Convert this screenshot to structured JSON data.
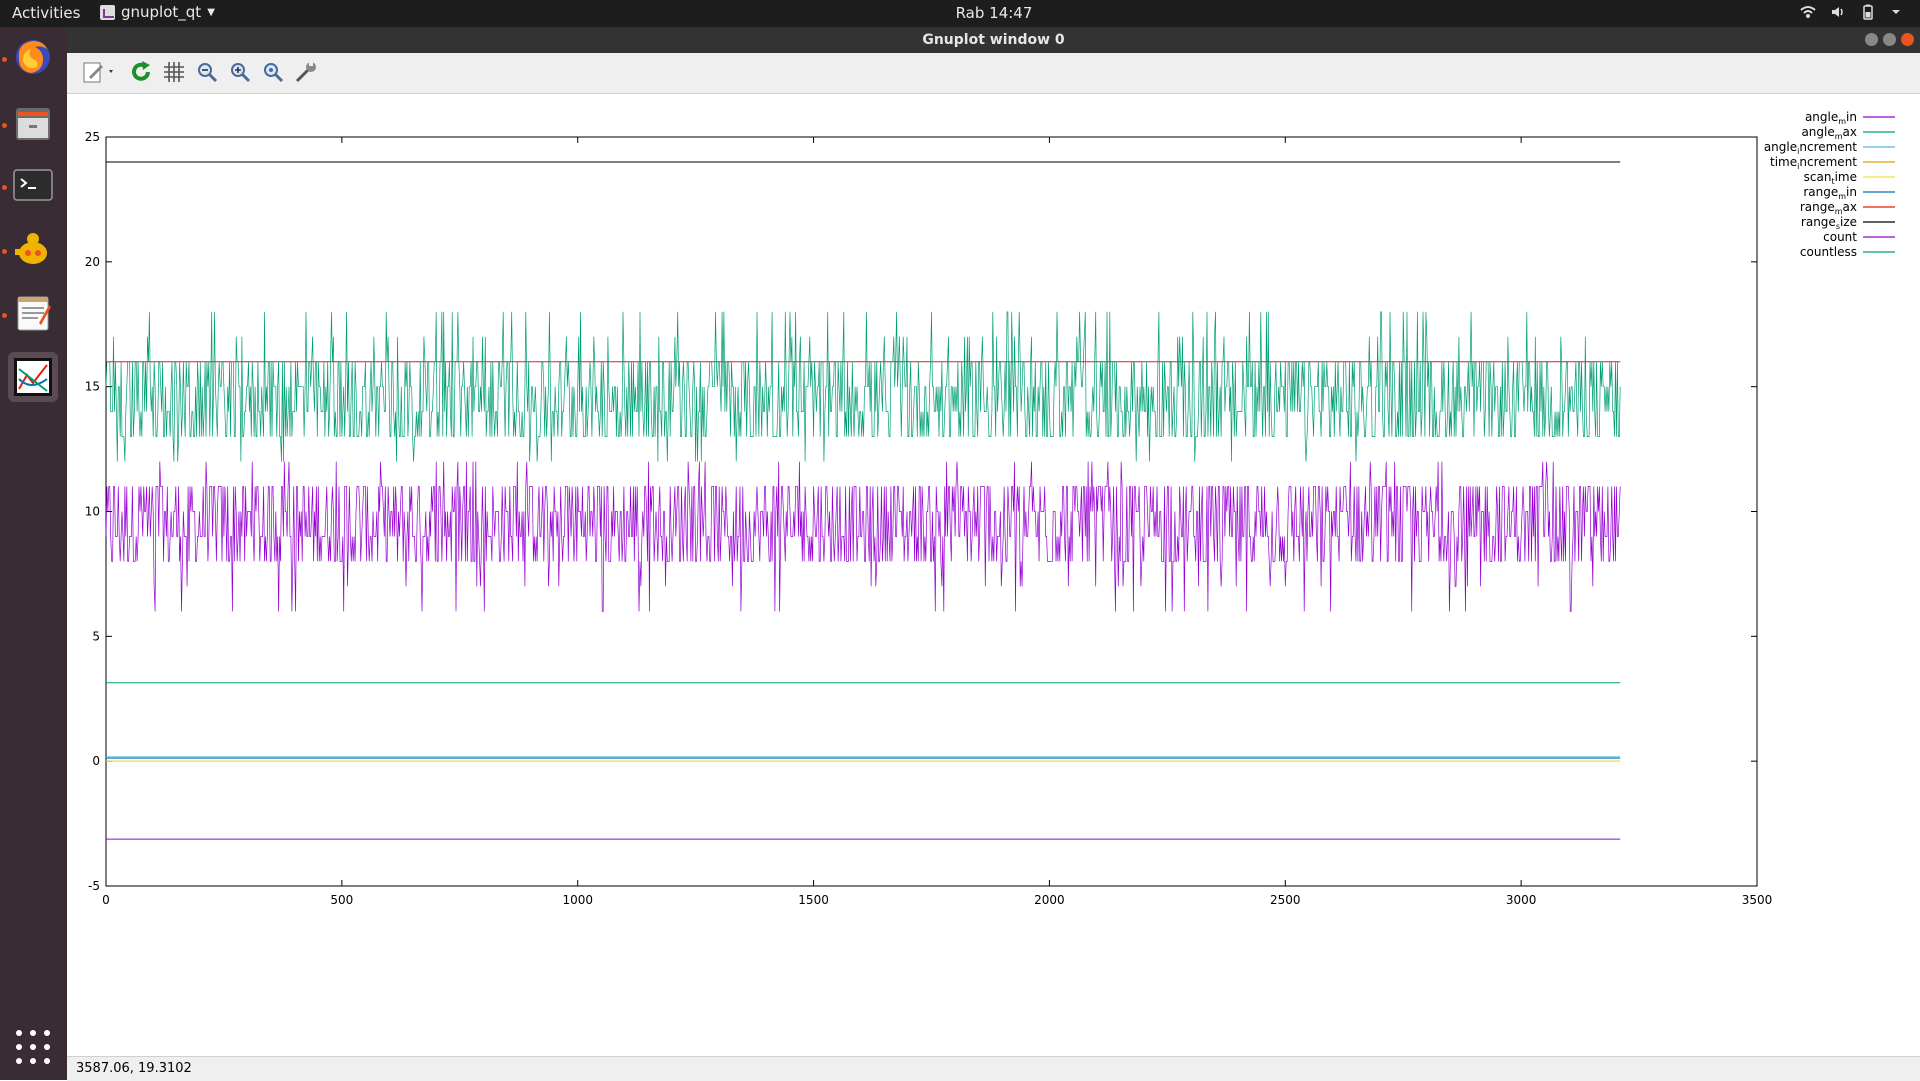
{
  "topbar": {
    "activities": "Activities",
    "app_menu": "gnuplot_qt",
    "clock": "Rab 14:47",
    "system_icons": [
      "wifi-icon",
      "volume-icon",
      "battery-icon",
      "power-menu-icon"
    ]
  },
  "dock": {
    "items": [
      "firefox",
      "files",
      "terminal",
      "synaptic",
      "text-editor",
      "gnuplot"
    ]
  },
  "window": {
    "title": "Gnuplot window 0",
    "toolbar": [
      "export-icon",
      "replot-icon",
      "grid-icon",
      "zoom-back-icon",
      "zoom-forward-icon",
      "unzoom-icon",
      "settings-icon"
    ],
    "status": "3587.06,  19.3102"
  },
  "colors": {
    "angle_min": "#9400d3",
    "angle_max": "#009e73",
    "angle_increment": "#56b4e9",
    "time_increment": "#e69f00",
    "scan_time": "#f0e442",
    "range_min": "#0072b2",
    "range_max": "#e51e10",
    "range_size": "#000000",
    "count": "#9400d3",
    "countless": "#009e73"
  },
  "chart_data": {
    "type": "line",
    "title": "",
    "xlabel": "",
    "ylabel": "",
    "xlim": [
      0,
      3500
    ],
    "ylim": [
      -5,
      25
    ],
    "xticks": [
      "0",
      "500",
      "1000",
      "1500",
      "2000",
      "2500",
      "3000",
      "3500"
    ],
    "yticks": [
      "-5",
      "0",
      "5",
      "10",
      "15",
      "20",
      "25"
    ],
    "grid": false,
    "legend_position": "top-right outside",
    "x_range_of_data": [
      0,
      3210
    ],
    "series": [
      {
        "name": "angle_min",
        "legend": [
          "angle",
          "m",
          "in"
        ],
        "kind": "constant",
        "value": -3.12,
        "color": "#9400d3"
      },
      {
        "name": "angle_max",
        "legend": [
          "angle",
          "m",
          "ax"
        ],
        "kind": "constant",
        "value": 3.14,
        "color": "#009e73"
      },
      {
        "name": "angle_increment",
        "legend": [
          "angle",
          "i",
          "ncrement"
        ],
        "kind": "constant",
        "value": 0.17,
        "color": "#56b4e9"
      },
      {
        "name": "time_increment",
        "legend": [
          "time",
          "i",
          "ncrement"
        ],
        "kind": "constant",
        "value": 0.0,
        "color": "#e69f00"
      },
      {
        "name": "scan_time",
        "legend": [
          "scan",
          "t",
          "ime"
        ],
        "kind": "constant",
        "value": 0.0,
        "color": "#f0e442"
      },
      {
        "name": "range_min",
        "legend": [
          "range",
          "m",
          "in"
        ],
        "kind": "constant",
        "value": 0.12,
        "color": "#0072b2"
      },
      {
        "name": "range_max",
        "legend": [
          "range",
          "m",
          "ax"
        ],
        "kind": "constant",
        "value": 16.0,
        "color": "#e51e10"
      },
      {
        "name": "range_size",
        "legend": [
          "range",
          "s",
          "ize"
        ],
        "kind": "constant",
        "value": 24.0,
        "color": "#000000"
      },
      {
        "name": "count",
        "legend": [
          "count",
          "",
          ""
        ],
        "kind": "noisy",
        "typical_range": [
          8,
          11
        ],
        "min": 6,
        "max": 12,
        "color": "#9400d3"
      },
      {
        "name": "countless",
        "legend": [
          "countless",
          "",
          ""
        ],
        "kind": "noisy",
        "typical_range": [
          13,
          16
        ],
        "min": 12,
        "max": 18,
        "color": "#009e73"
      }
    ]
  }
}
